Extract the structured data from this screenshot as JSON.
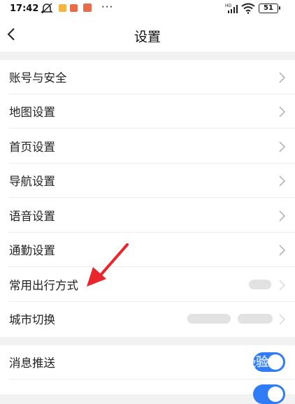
{
  "status_bar": {
    "time": "17:42",
    "battery": "51"
  },
  "nav": {
    "title": "设置"
  },
  "settings_group_1": [
    {
      "label": "账号与安全"
    },
    {
      "label": "地图设置"
    },
    {
      "label": "首页设置"
    },
    {
      "label": "导航设置"
    },
    {
      "label": "语音设置"
    },
    {
      "label": "通勤设置"
    },
    {
      "label": "常用出行方式"
    },
    {
      "label": "城市切换"
    }
  ],
  "settings_group_2": [
    {
      "label": "消息推送",
      "enabled": true
    }
  ],
  "colors": {
    "accent": "#2f7cf6",
    "annotation": "#e8262b"
  },
  "watermark": "Baidu 经验"
}
